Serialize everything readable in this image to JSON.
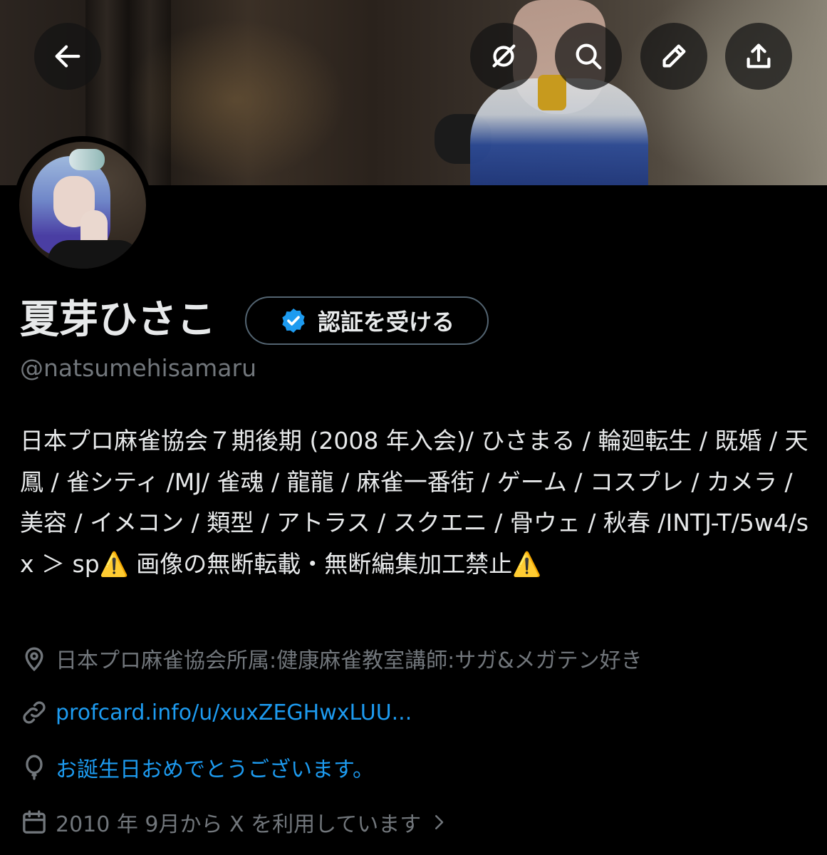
{
  "header": {
    "back_icon": "arrow-left-icon",
    "grok_icon": "grok-icon",
    "search_icon": "search-icon",
    "edit_icon": "pencil-icon",
    "share_icon": "share-upload-icon"
  },
  "profile": {
    "display_name": "夏芽ひさこ",
    "verify_button_label": "認証を受ける",
    "handle": "@natsumehisamaru",
    "bio": "日本プロ麻雀協会７期後期 (2008 年入会)/ ひさまる / 輪廻転生 / 既婚 / 天鳳 / 雀シティ /MJ/ 雀魂 / 龍龍 / 麻雀一番街 / ゲーム / コスプレ / カメラ / 美容 / イメコン / 類型 / アトラス / スクエニ / 骨ウェ / 秋春 /INTJ-T/5w4/sx ＞ sp⚠️ 画像の無断転載・無断編集加工禁止⚠️",
    "location": "日本プロ麻雀協会所属:健康麻雀教室講師:サガ&メガテン好き",
    "website": "profcard.info/u/xuxZEGHwxLUU...",
    "birthday": "お誕生日おめでとうございます。",
    "joined": "2010 年 9月から X を利用しています"
  },
  "colors": {
    "background": "#000000",
    "text_primary": "#e7e9ea",
    "text_secondary": "#71767b",
    "link": "#1d9bf0",
    "verified_badge": "#1d9bf0"
  }
}
